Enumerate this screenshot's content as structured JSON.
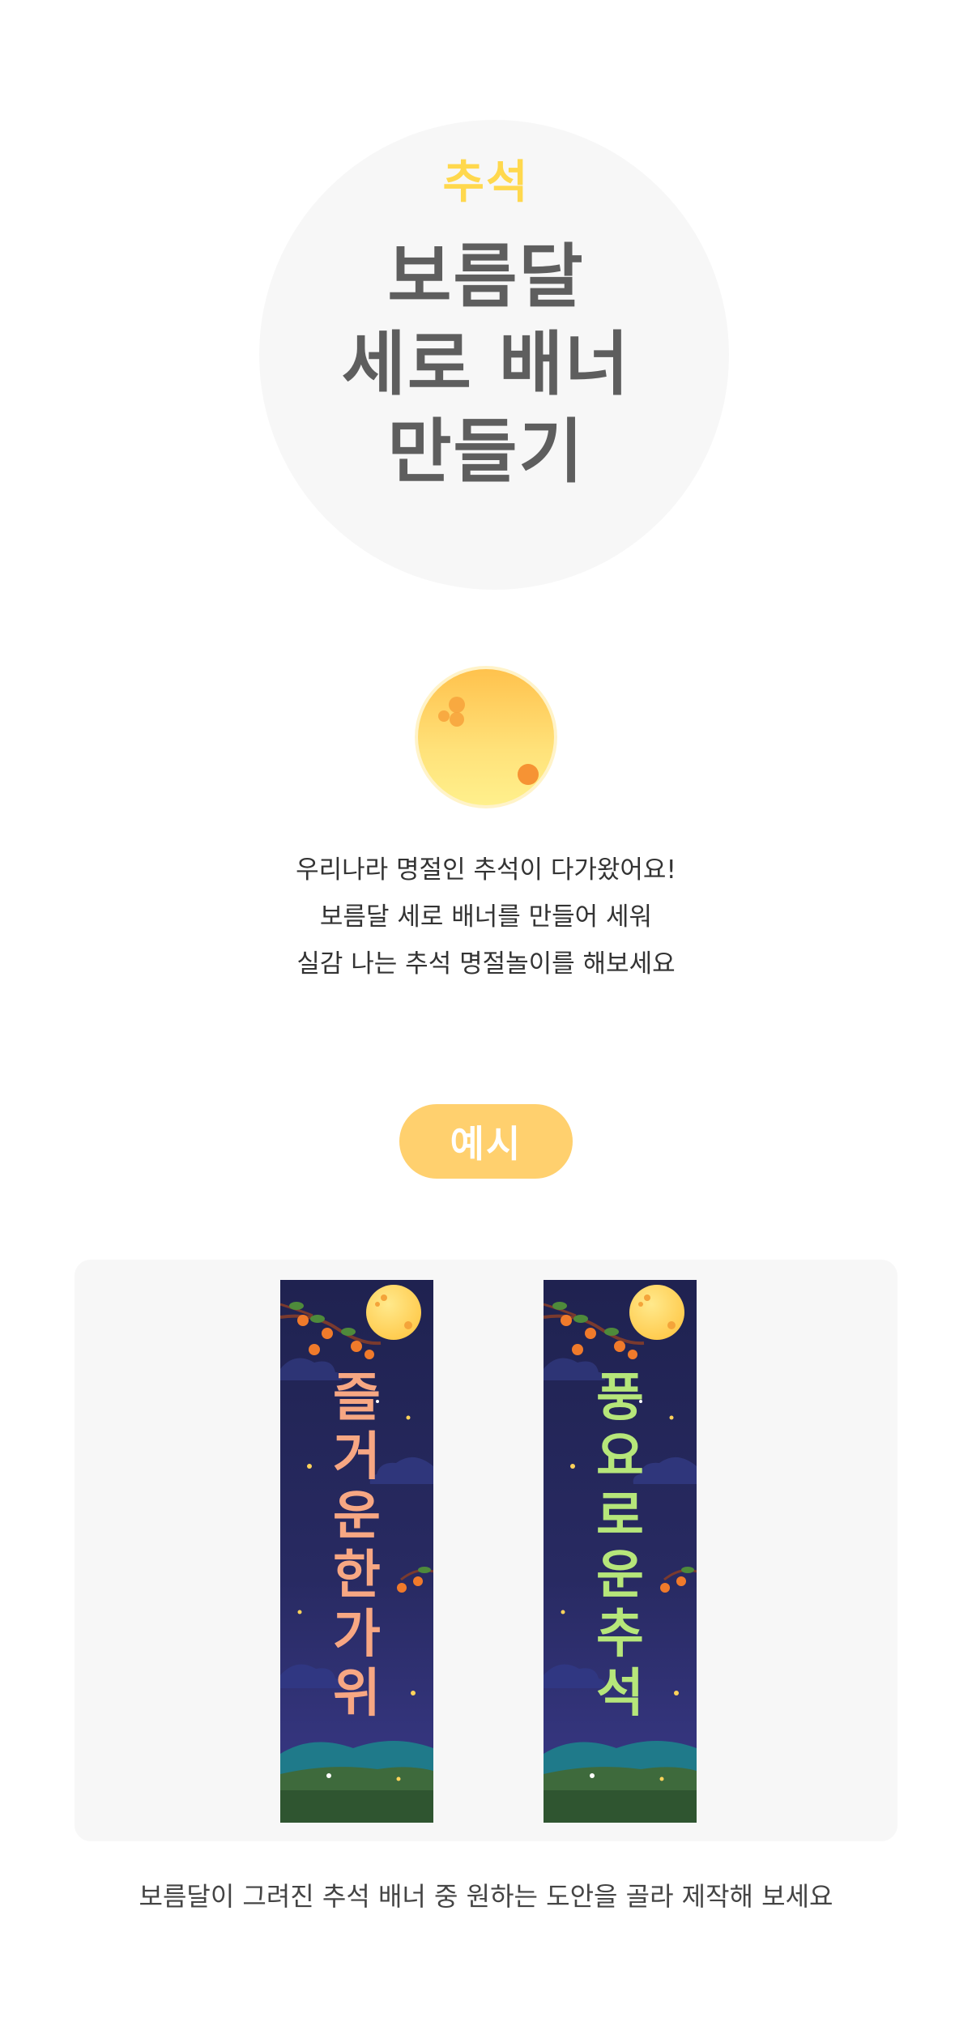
{
  "hero": {
    "tag": "추석",
    "title_lines": [
      "보름달",
      "세로 배너",
      "만들기"
    ]
  },
  "intro": {
    "lines": [
      "우리나라 명절인 추석이 다가왔어요!",
      "보름달 세로 배너를 만들어 세워",
      "실감 나는 추석 명절놀이를 해보세요"
    ]
  },
  "example": {
    "label": "예시",
    "banners": [
      {
        "chars": [
          "즐",
          "거",
          "운",
          "한",
          "가",
          "위"
        ],
        "text_color": "#f7a783"
      },
      {
        "chars": [
          "풍",
          "요",
          "로",
          "운",
          "추",
          "석"
        ],
        "text_color": "#b6e67a"
      }
    ]
  },
  "caption": "보름달이 그려진 추석 배너 중 원하는 도안을 골라 제작해 보세요",
  "colors": {
    "tag_yellow": "#ffd84d",
    "title_gray": "#5e5e5e",
    "pill_orange": "#ffd06e",
    "panel_bg": "#f7f7f7",
    "banner_sky": "#262755"
  }
}
